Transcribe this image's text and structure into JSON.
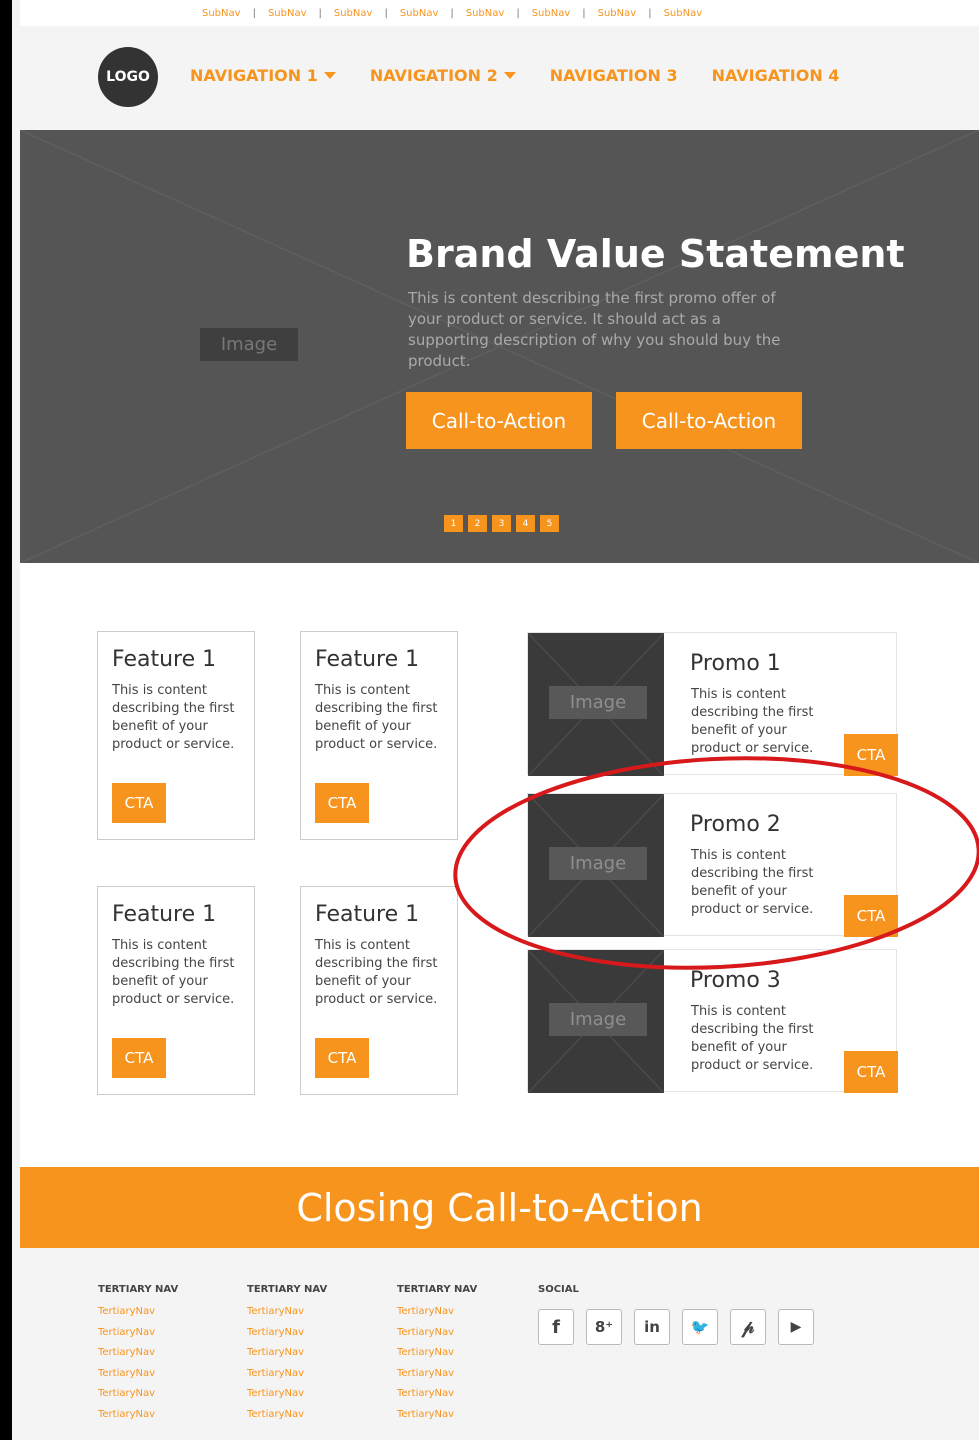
{
  "subnav": [
    "SubNav",
    "SubNav",
    "SubNav",
    "SubNav",
    "SubNav",
    "SubNav",
    "SubNav",
    "SubNav"
  ],
  "header": {
    "logo": "LOGO",
    "nav": [
      {
        "label": "NAVIGATION 1",
        "dropdown": true
      },
      {
        "label": "NAVIGATION 2",
        "dropdown": true
      },
      {
        "label": "NAVIGATION 3",
        "dropdown": false
      },
      {
        "label": "NAVIGATION 4",
        "dropdown": false
      }
    ]
  },
  "hero": {
    "image_label": "Image",
    "title": "Brand Value Statement",
    "description": "This is content describing the first promo offer of your product or service. It should act as a supporting description of why you should buy the product.",
    "cta1": "Call-to-Action",
    "cta2": "Call-to-Action",
    "pager": [
      "1",
      "2",
      "3",
      "4",
      "5"
    ]
  },
  "features": [
    {
      "title": "Feature 1",
      "text": "This is content describing the first benefit of your product or service.",
      "cta": "CTA"
    },
    {
      "title": "Feature 1",
      "text": "This is content describing the first benefit of your product or service.",
      "cta": "CTA"
    },
    {
      "title": "Feature 1",
      "text": "This is content describing the first benefit of your product or service.",
      "cta": "CTA"
    },
    {
      "title": "Feature 1",
      "text": "This is content describing the first benefit of your product or service.",
      "cta": "CTA"
    }
  ],
  "promos": [
    {
      "title": "Promo 1",
      "image_label": "Image",
      "text": "This is content describing the first benefit of your product or service.",
      "cta": "CTA"
    },
    {
      "title": "Promo 2",
      "image_label": "Image",
      "text": "This is content describing the first benefit of your product or service.",
      "cta": "CTA"
    },
    {
      "title": "Promo 3",
      "image_label": "Image",
      "text": "This is content describing the first benefit of your product or service.",
      "cta": "CTA"
    }
  ],
  "closing": "Closing Call-to-Action",
  "footer": {
    "columns": [
      {
        "heading": "TERTIARY NAV",
        "links": [
          "TertiaryNav",
          "TertiaryNav",
          "TertiaryNav",
          "TertiaryNav",
          "TertiaryNav",
          "TertiaryNav"
        ]
      },
      {
        "heading": "TERTIARY NAV",
        "links": [
          "TertiaryNav",
          "TertiaryNav",
          "TertiaryNav",
          "TertiaryNav",
          "TertiaryNav",
          "TertiaryNav"
        ]
      },
      {
        "heading": "TERTIARY NAV",
        "links": [
          "TertiaryNav",
          "TertiaryNav",
          "TertiaryNav",
          "TertiaryNav",
          "TertiaryNav",
          "TertiaryNav"
        ]
      }
    ],
    "social_heading": "SOCIAL",
    "social": [
      {
        "icon": "facebook-icon",
        "glyph": "f"
      },
      {
        "icon": "google-plus-icon",
        "glyph": "8⁺"
      },
      {
        "icon": "linkedin-icon",
        "glyph": "in"
      },
      {
        "icon": "twitter-icon",
        "glyph": "🐦"
      },
      {
        "icon": "pinterest-icon",
        "glyph": "𝓅"
      },
      {
        "icon": "youtube-icon",
        "glyph": "▶"
      }
    ]
  },
  "colors": {
    "accent": "#f7941d",
    "hero_bg": "#555555",
    "annotation": "#d7191c"
  }
}
